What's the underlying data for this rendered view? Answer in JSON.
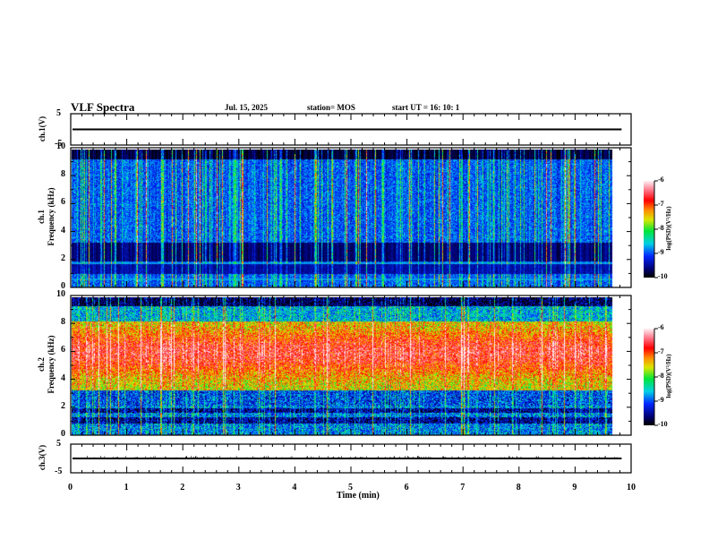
{
  "header": {
    "title": "VLF Spectra",
    "date": "Jul. 15, 2025",
    "station": "station= MOS",
    "start": "start UT =  16: 10: 1"
  },
  "chart_data": [
    {
      "type": "line",
      "ylabel": "ch.1(V)",
      "ylim": [
        -5,
        5
      ],
      "yticks": [
        "5",
        "-5"
      ],
      "xlim": [
        0,
        10
      ],
      "level": 0,
      "x_end": 9.83
    },
    {
      "type": "heatmap",
      "ylabel": "ch.1\nFrequency (kHz)",
      "ylabel_lines": [
        "ch.1",
        "Frequency (kHz)"
      ],
      "ylim": [
        0,
        10
      ],
      "yticks": [
        "0",
        "2",
        "4",
        "6",
        "8",
        "10"
      ],
      "xlim": [
        0,
        10
      ],
      "x_end": 9.83,
      "colorbar": {
        "label": "log(PSD)(V²/Hz)",
        "range": [
          -10,
          -6
        ],
        "ticks": [
          "-6",
          "-7",
          "-8",
          "-9",
          "-10"
        ]
      },
      "description_bands_khz": [
        0.6,
        1.8
      ]
    },
    {
      "type": "heatmap",
      "ylabel_lines": [
        "ch.2",
        "Frequency (kHz)"
      ],
      "ylim": [
        0,
        10
      ],
      "yticks": [
        "0",
        "2",
        "4",
        "6",
        "8",
        "10"
      ],
      "xlim": [
        0,
        10
      ],
      "x_end": 9.83,
      "colorbar": {
        "label": "log(PSD)(V²/Hz)",
        "range": [
          -10,
          -6
        ],
        "ticks": [
          "-6",
          "-7",
          "-8",
          "-9",
          "-10"
        ]
      }
    },
    {
      "type": "line",
      "ylabel": "ch.3(V)",
      "ylim": [
        -5,
        5
      ],
      "yticks": [
        "5",
        "-5"
      ],
      "xlim": [
        0,
        10
      ],
      "level": 0,
      "x_end": 9.83
    }
  ],
  "xaxis": {
    "label": "Time (min)",
    "ticks": [
      "0",
      "1",
      "2",
      "3",
      "4",
      "5",
      "6",
      "7",
      "8",
      "9",
      "10"
    ]
  }
}
